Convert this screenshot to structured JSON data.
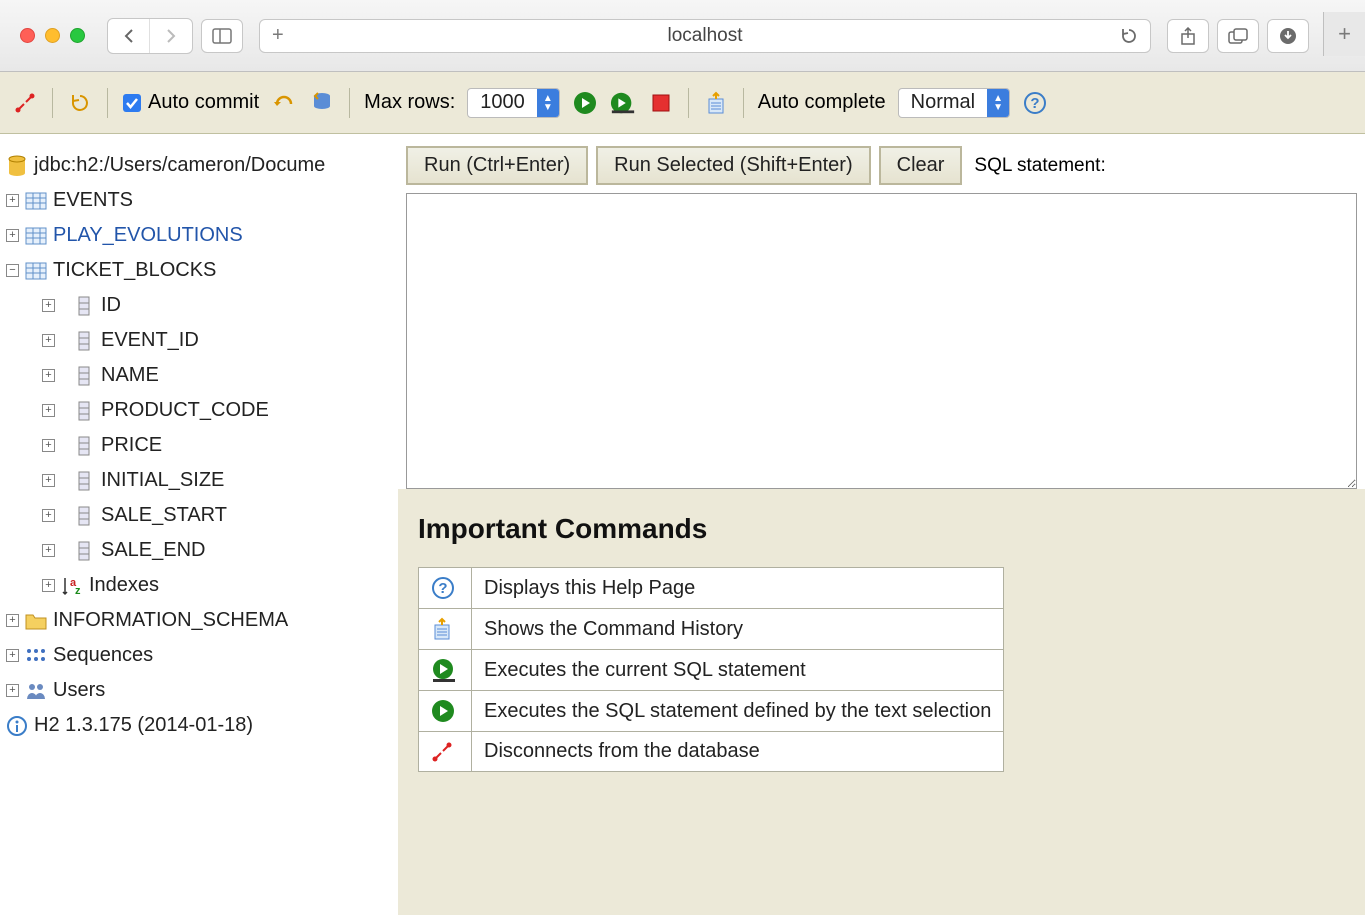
{
  "browser": {
    "url": "localhost"
  },
  "toolbar": {
    "autocommit_label": "Auto commit",
    "maxrows_label": "Max rows:",
    "maxrows_value": "1000",
    "autocomplete_label": "Auto complete",
    "autocomplete_value": "Normal"
  },
  "tree": {
    "db_url": "jdbc:h2:/Users/cameron/Docume",
    "tables": [
      {
        "name": "EVENTS",
        "expanded": false,
        "link": false
      },
      {
        "name": "PLAY_EVOLUTIONS",
        "expanded": false,
        "link": true
      },
      {
        "name": "TICKET_BLOCKS",
        "expanded": true,
        "link": false
      }
    ],
    "ticket_columns": [
      "ID",
      "EVENT_ID",
      "NAME",
      "PRODUCT_CODE",
      "PRICE",
      "INITIAL_SIZE",
      "SALE_START",
      "SALE_END"
    ],
    "indexes_label": "Indexes",
    "info_schema": "INFORMATION_SCHEMA",
    "sequences": "Sequences",
    "users": "Users",
    "version": "H2 1.3.175 (2014-01-18)"
  },
  "buttons": {
    "run": "Run (Ctrl+Enter)",
    "run_selected": "Run Selected (Shift+Enter)",
    "clear": "Clear",
    "sql_label": "SQL statement:"
  },
  "results": {
    "heading": "Important Commands",
    "rows": [
      "Displays this Help Page",
      "Shows the Command History",
      "Executes the current SQL statement",
      "Executes the SQL statement defined by the text selection",
      "Disconnects from the database"
    ]
  }
}
